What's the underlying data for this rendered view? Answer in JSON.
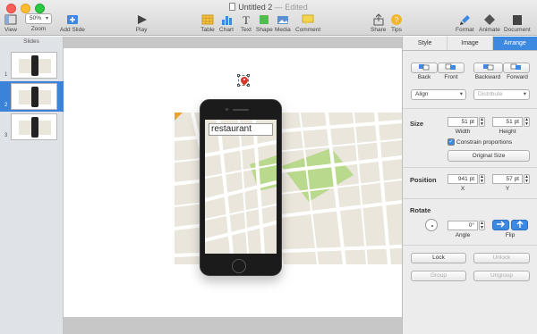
{
  "window": {
    "title": "Untitled 2",
    "status": "— Edited"
  },
  "toolbar": {
    "view": "View",
    "zoom_value": "50%",
    "zoom": "Zoom",
    "add_slide": "Add Slide",
    "play": "Play",
    "table": "Table",
    "chart": "Chart",
    "text": "Text",
    "shape": "Shape",
    "media": "Media",
    "comment": "Comment",
    "share": "Share",
    "tips": "Tips",
    "format": "Format",
    "animate": "Animate",
    "document": "Document"
  },
  "navigator": {
    "header": "Slides",
    "slides": [
      "1",
      "2",
      "3"
    ],
    "selected": "2"
  },
  "slide": {
    "search_text": "restaurant"
  },
  "inspector": {
    "tabs": [
      "Style",
      "Image",
      "Arrange"
    ],
    "active_tab": "Arrange",
    "back": "Back",
    "front": "Front",
    "backward": "Backward",
    "forward": "Forward",
    "align": "Align",
    "distribute": "Distribute",
    "size_label": "Size",
    "width_value": "51 pt",
    "height_value": "51 pt",
    "width": "Width",
    "height": "Height",
    "constrain": "Constrain proportions",
    "original_size": "Original Size",
    "position_label": "Position",
    "x_value": "941 pt",
    "y_value": "57 pt",
    "x": "X",
    "y": "Y",
    "rotate_label": "Rotate",
    "angle_value": "0°",
    "angle": "Angle",
    "flip": "Flip",
    "lock": "Lock",
    "unlock": "Unlock",
    "group": "Group",
    "ungroup": "Ungroup"
  },
  "colors": {
    "accent": "#3e89e0",
    "pin": "#d8362a",
    "map": "#eae6dc",
    "park": "#b9d98d"
  }
}
